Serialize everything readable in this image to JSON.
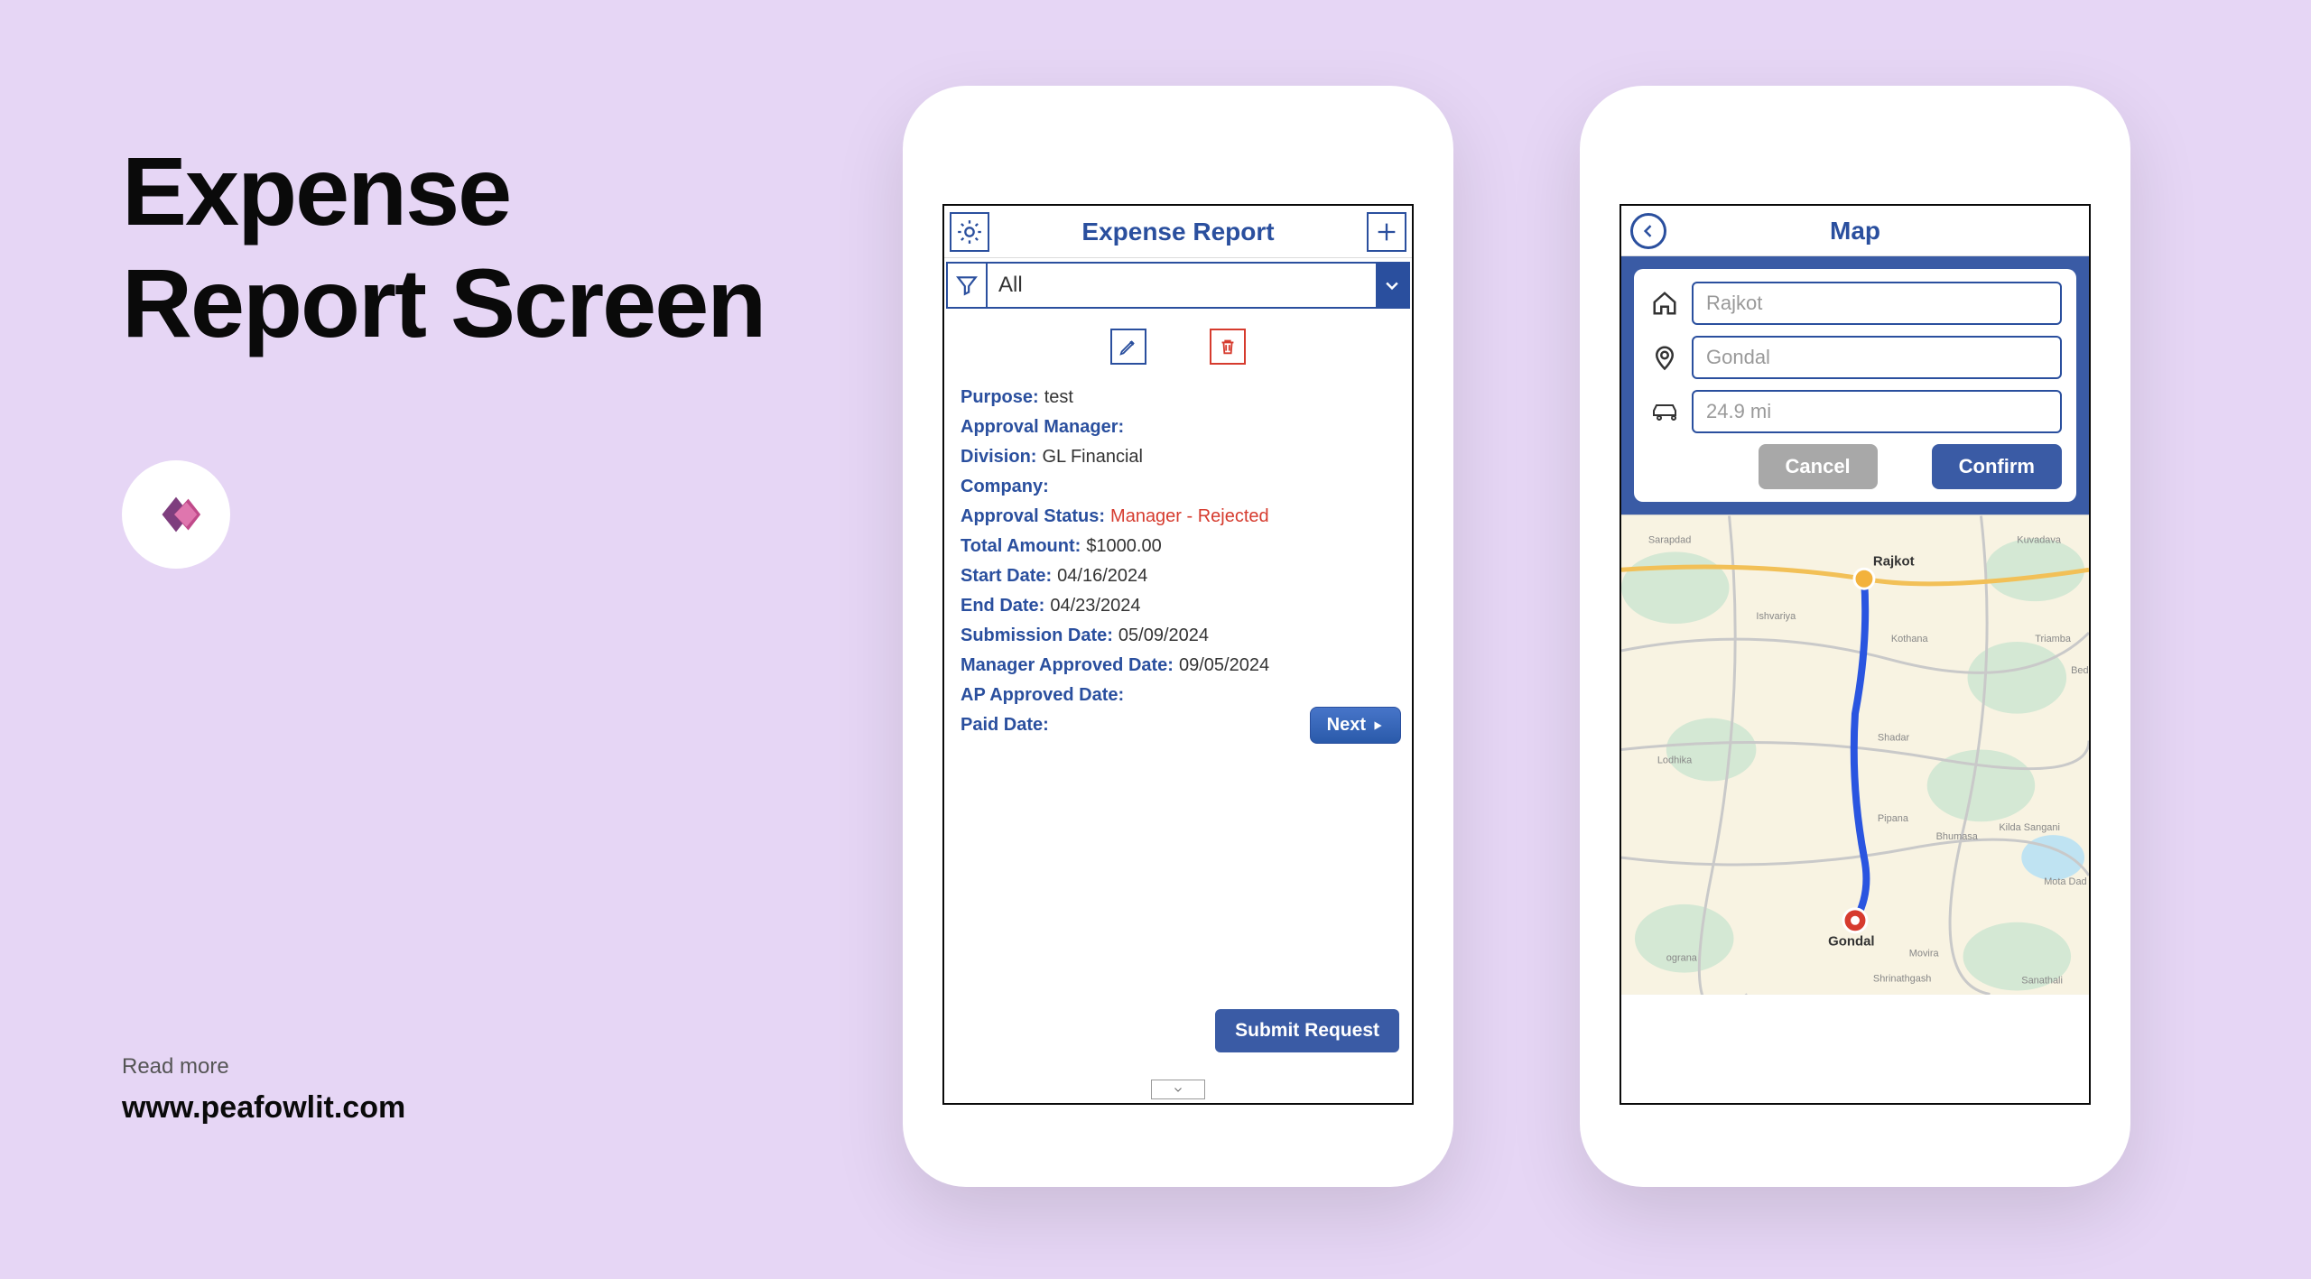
{
  "promo": {
    "title_line1": "Expense",
    "title_line2": "Report Screen",
    "read_more": "Read more",
    "url": "www.peafowlit.com"
  },
  "expense_app": {
    "header_title": "Expense Report",
    "filter_value": "All",
    "next_label": "Next",
    "submit_label": "Submit Request",
    "labels": {
      "purpose": "Purpose:",
      "approval_manager": "Approval Manager:",
      "division": "Division:",
      "company": "Company:",
      "approval_status": "Approval Status:",
      "total_amount": "Total Amount:",
      "start_date": "Start Date:",
      "end_date": "End Date:",
      "submission_date": "Submission Date:",
      "manager_approved_date": "Manager Approved Date:",
      "ap_approved_date": "AP Approved Date:",
      "paid_date": "Paid Date:"
    },
    "values": {
      "purpose": "test",
      "approval_manager": "",
      "division": "GL Financial",
      "company": "",
      "approval_status": "Manager - Rejected",
      "total_amount": "$1000.00",
      "start_date": "04/16/2024",
      "end_date": "04/23/2024",
      "submission_date": "05/09/2024",
      "manager_approved_date": "09/05/2024",
      "ap_approved_date": "",
      "paid_date": ""
    }
  },
  "map_app": {
    "header_title": "Map",
    "from": "Rajkot",
    "to": "Gondal",
    "distance": "24.9 mi",
    "cancel_label": "Cancel",
    "confirm_label": "Confirm",
    "route_start_label": "Rajkot",
    "route_end_label": "Gondal"
  }
}
